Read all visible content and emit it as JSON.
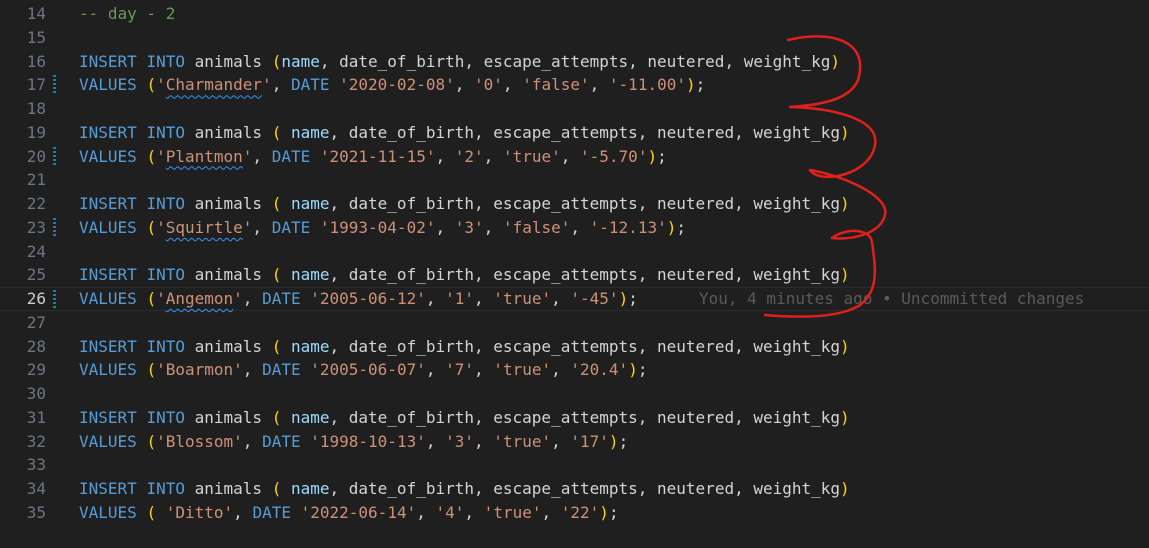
{
  "comment_line": {
    "number": "14",
    "text": "-- day - 2"
  },
  "blank_lines": [
    "15",
    "18",
    "21",
    "24",
    "27",
    "30",
    "33"
  ],
  "keywords": {
    "insert": "INSERT",
    "into": "INTO",
    "values": "VALUES",
    "date": "DATE"
  },
  "table": "animals",
  "columns": {
    "name": "name",
    "rest": "date_of_birth, escape_attempts, neutered, weight_kg"
  },
  "inserts": [
    {
      "insert_line": "16",
      "values_line": "17",
      "name": "Charmander",
      "dob": "2020-02-08",
      "attempts": "0",
      "neutered": "false",
      "weight": "-11.00"
    },
    {
      "insert_line": "19",
      "values_line": "20",
      "name": "Plantmon",
      "dob": "2021-11-15",
      "attempts": "2",
      "neutered": "true",
      "weight": "-5.70"
    },
    {
      "insert_line": "22",
      "values_line": "23",
      "name": "Squirtle",
      "dob": "1993-04-02",
      "attempts": "3",
      "neutered": "false",
      "weight": "-12.13"
    },
    {
      "insert_line": "25",
      "values_line": "26",
      "name": "Angemon",
      "dob": "2005-06-12",
      "attempts": "1",
      "neutered": "true",
      "weight": "-45"
    },
    {
      "insert_line": "28",
      "values_line": "29",
      "name": "Boarmon",
      "dob": "2005-06-07",
      "attempts": "7",
      "neutered": "true",
      "weight": "20.4"
    },
    {
      "insert_line": "31",
      "values_line": "32",
      "name": "Blossom",
      "dob": "1998-10-13",
      "attempts": "3",
      "neutered": "true",
      "weight": "17"
    },
    {
      "insert_line": "34",
      "values_line": "35",
      "name": "Ditto",
      "dob": "2022-06-14",
      "attempts": "4",
      "neutered": "true",
      "weight": "22"
    }
  ],
  "blame": "You, 4 minutes ago • Uncommitted changes",
  "colors": {
    "background": "#1f1f1f",
    "keyword": "#569cd6",
    "string": "#ce9178",
    "comment": "#6a9955",
    "bracket": "#ffd700",
    "annotation": "#e0201c"
  }
}
